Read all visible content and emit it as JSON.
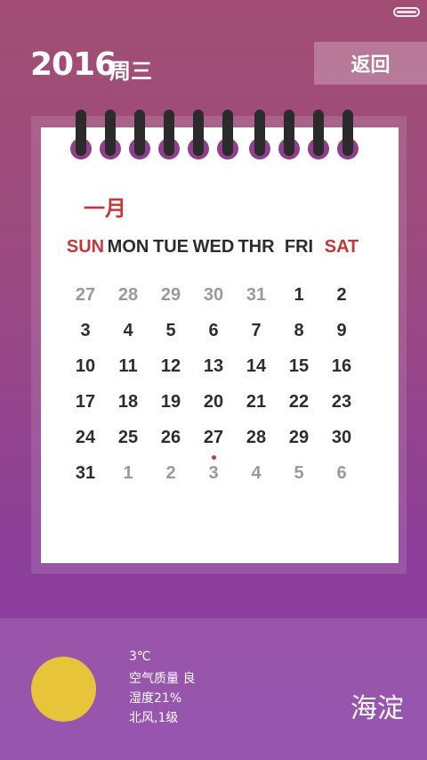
{
  "header": {
    "year": "2016",
    "weekday": "周三",
    "back_label": "返回"
  },
  "calendar": {
    "month": "一月",
    "weekdays": [
      {
        "label": "SUN",
        "highlight": true
      },
      {
        "label": "MON",
        "highlight": false
      },
      {
        "label": "TUE",
        "highlight": false
      },
      {
        "label": "WED",
        "highlight": false
      },
      {
        "label": "THR",
        "highlight": false
      },
      {
        "label": "FRI",
        "highlight": false
      },
      {
        "label": "SAT",
        "highlight": true
      }
    ],
    "weeks": [
      [
        {
          "d": "27",
          "m": true
        },
        {
          "d": "28",
          "m": true
        },
        {
          "d": "29",
          "m": true
        },
        {
          "d": "30",
          "m": true
        },
        {
          "d": "31",
          "m": true
        },
        {
          "d": "1",
          "m": false
        },
        {
          "d": "2",
          "m": false
        }
      ],
      [
        {
          "d": "3",
          "m": false
        },
        {
          "d": "4",
          "m": false
        },
        {
          "d": "5",
          "m": false
        },
        {
          "d": "6",
          "m": false
        },
        {
          "d": "7",
          "m": false
        },
        {
          "d": "8",
          "m": false
        },
        {
          "d": "9",
          "m": false
        }
      ],
      [
        {
          "d": "10",
          "m": false
        },
        {
          "d": "11",
          "m": false
        },
        {
          "d": "12",
          "m": false
        },
        {
          "d": "13",
          "m": false
        },
        {
          "d": "14",
          "m": false
        },
        {
          "d": "15",
          "m": false
        },
        {
          "d": "16",
          "m": false
        }
      ],
      [
        {
          "d": "17",
          "m": false
        },
        {
          "d": "18",
          "m": false
        },
        {
          "d": "19",
          "m": false
        },
        {
          "d": "20",
          "m": false
        },
        {
          "d": "21",
          "m": false
        },
        {
          "d": "22",
          "m": false
        },
        {
          "d": "23",
          "m": false
        }
      ],
      [
        {
          "d": "24",
          "m": false
        },
        {
          "d": "25",
          "m": false
        },
        {
          "d": "26",
          "m": false
        },
        {
          "d": "27",
          "m": false
        },
        {
          "d": "28",
          "m": false
        },
        {
          "d": "29",
          "m": false
        },
        {
          "d": "30",
          "m": false
        }
      ],
      [
        {
          "d": "31",
          "m": false
        },
        {
          "d": "1",
          "m": true
        },
        {
          "d": "2",
          "m": true
        },
        {
          "d": "3",
          "m": true,
          "today": true
        },
        {
          "d": "4",
          "m": true
        },
        {
          "d": "5",
          "m": true
        },
        {
          "d": "6",
          "m": true
        }
      ]
    ],
    "colors": {
      "accent": "#c7373a",
      "muted": "#9a9a9a",
      "text": "#2d2d2d"
    }
  },
  "weather": {
    "temperature": "3℃",
    "air_quality": "空气质量 良",
    "humidity": "湿度21%",
    "wind": "北风,1级",
    "city": "海淀",
    "icon": "sun-icon",
    "sun_color": "#e8c43a"
  }
}
